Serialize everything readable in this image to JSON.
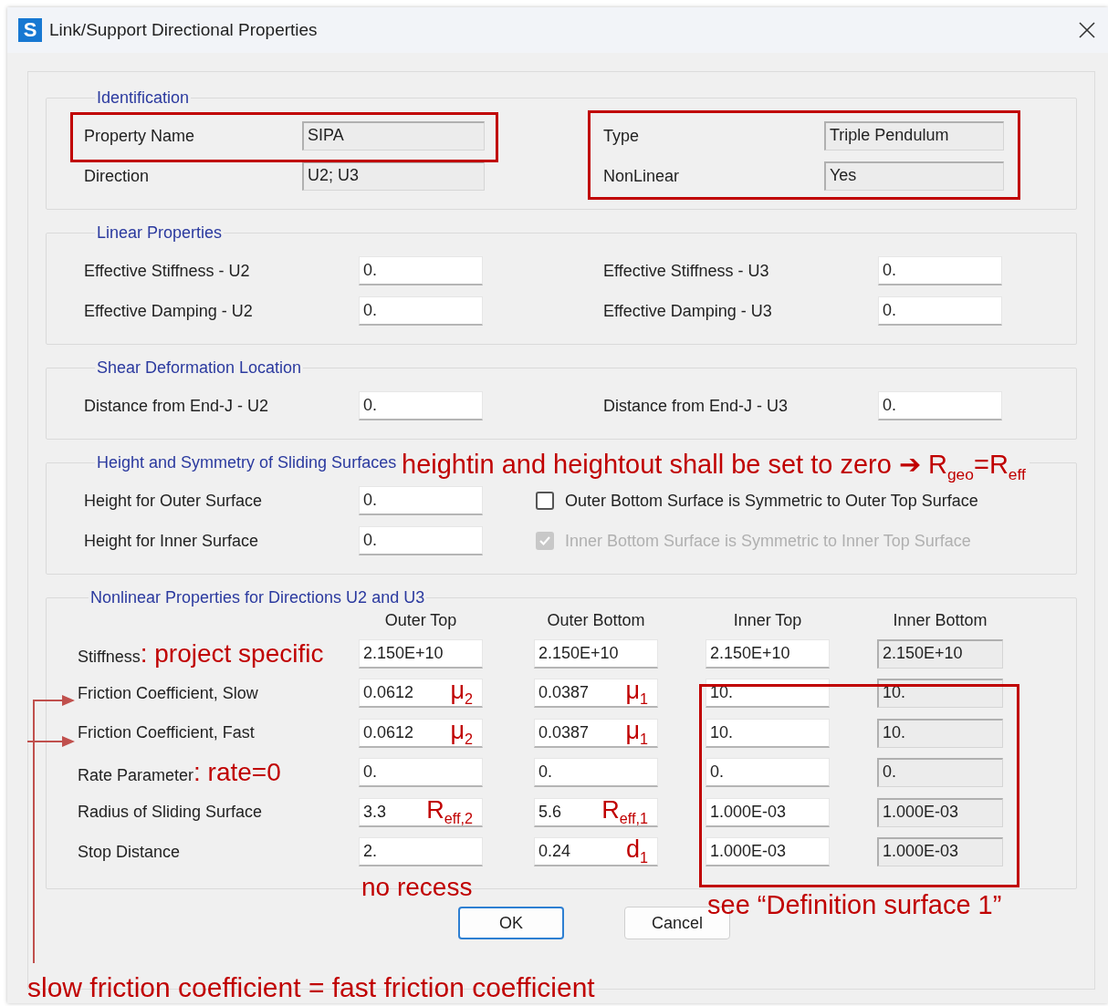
{
  "window": {
    "icon_letter": "S",
    "title": "Link/Support Directional Properties"
  },
  "identification": {
    "title": "Identification",
    "left": [
      {
        "label": "Property Name",
        "value": "SIPA",
        "readonly": true
      },
      {
        "label": "Direction",
        "value": "U2; U3",
        "readonly": true
      }
    ],
    "right": [
      {
        "label": "Type",
        "value": "Triple Pendulum",
        "readonly": true
      },
      {
        "label": "NonLinear",
        "value": "Yes",
        "readonly": true
      }
    ]
  },
  "linear": {
    "title": "Linear Properties",
    "left": [
      {
        "label": "Effective Stiffness - U2",
        "value": "0.",
        "readonly": false
      },
      {
        "label": "Effective Damping - U2",
        "value": "0.",
        "readonly": false
      }
    ],
    "right": [
      {
        "label": "Effective Stiffness - U3",
        "value": "0.",
        "readonly": false
      },
      {
        "label": "Effective Damping - U3",
        "value": "0.",
        "readonly": false
      }
    ]
  },
  "shear": {
    "title": "Shear Deformation Location",
    "left": [
      {
        "label": "Distance from End-J - U2",
        "value": "0.",
        "readonly": false
      }
    ],
    "right": [
      {
        "label": "Distance from End-J - U3",
        "value": "0.",
        "readonly": false
      }
    ]
  },
  "height": {
    "title": "Height and Symmetry of Sliding Surfaces",
    "left": [
      {
        "label": "Height for Outer Surface",
        "value": "0.",
        "readonly": false
      },
      {
        "label": "Height for Inner Surface",
        "value": "0.",
        "readonly": false
      }
    ],
    "checkboxes": [
      {
        "label": "Outer Bottom Surface is Symmetric to Outer Top Surface",
        "checked": false,
        "disabled": false
      },
      {
        "label": "Inner Bottom Surface is Symmetric to Inner Top Surface",
        "checked": true,
        "disabled": true
      }
    ]
  },
  "nonlinear": {
    "title": "Nonlinear Properties for Directions U2 and U3",
    "columns": [
      "Outer Top",
      "Outer Bottom",
      "Inner Top",
      "Inner Bottom"
    ],
    "rows": [
      {
        "label": "Stiffness",
        "note": ": project specific",
        "cells": [
          {
            "value": "2.150E+10",
            "readonly": false
          },
          {
            "value": "2.150E+10",
            "readonly": false
          },
          {
            "value": "2.150E+10",
            "readonly": false
          },
          {
            "value": "2.150E+10",
            "readonly": true
          }
        ]
      },
      {
        "label": "Friction Coefficient, Slow",
        "cells": [
          {
            "value": "0.0612",
            "note": "μ$_{2}$",
            "readonly": false
          },
          {
            "value": "0.0387",
            "note": "μ$_{1}$",
            "readonly": false
          },
          {
            "value": "10.",
            "readonly": false
          },
          {
            "value": "10.",
            "readonly": true
          }
        ]
      },
      {
        "label": "Friction Coefficient, Fast",
        "cells": [
          {
            "value": "0.0612",
            "note": "μ$_{2}$",
            "readonly": false
          },
          {
            "value": "0.0387",
            "note": "μ$_{1}$",
            "readonly": false
          },
          {
            "value": "10.",
            "readonly": false
          },
          {
            "value": "10.",
            "readonly": true
          }
        ]
      },
      {
        "label": "Rate Parameter",
        "note": ": rate=0",
        "cells": [
          {
            "value": "0.",
            "readonly": false
          },
          {
            "value": "0.",
            "readonly": false
          },
          {
            "value": "0.",
            "readonly": false
          },
          {
            "value": "0.",
            "readonly": true
          }
        ]
      },
      {
        "label": "Radius of Sliding Surface",
        "cells": [
          {
            "value": "3.3",
            "note": "R$_{eff,2}$",
            "readonly": false
          },
          {
            "value": "5.6",
            "note": "R$_{eff,1}$",
            "readonly": false
          },
          {
            "value": "1.000E-03",
            "readonly": false
          },
          {
            "value": "1.000E-03",
            "readonly": true
          }
        ]
      },
      {
        "label": "Stop Distance",
        "cells": [
          {
            "value": "2.",
            "readonly": false
          },
          {
            "value": "0.24",
            "note": "d$_{1}$",
            "readonly": false
          },
          {
            "value": "1.000E-03",
            "readonly": false
          },
          {
            "value": "1.000E-03",
            "readonly": true
          }
        ]
      }
    ]
  },
  "buttons": [
    {
      "label": "OK",
      "default": true
    },
    {
      "label": "Cancel",
      "default": false
    }
  ],
  "annotations": {
    "height_note": "heightin and heightout shall be set to zero ➔ R$_{geo}$=R$_{eff}$",
    "stop_note": "no recess",
    "inner_note": "see “Definition surface 1”",
    "friction_note": "slow friction coefficient = fast friction coefficient"
  }
}
